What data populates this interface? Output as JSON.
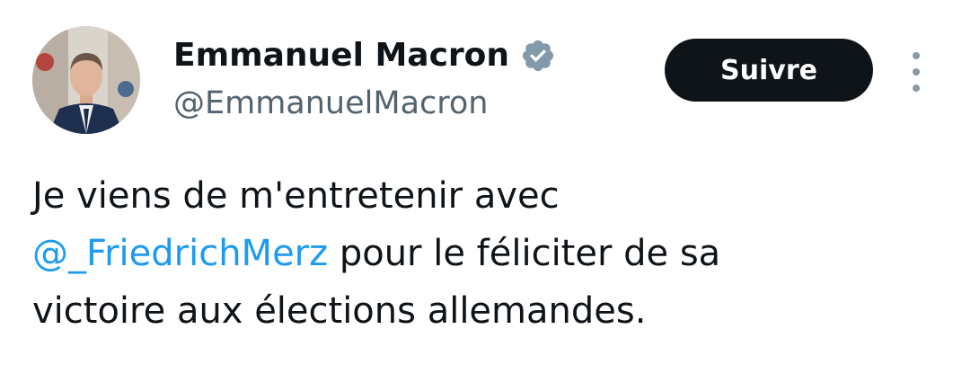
{
  "author": {
    "display_name": "Emmanuel Macron",
    "handle": "@EmmanuelMacron",
    "verified_icon": "verified-badge-icon",
    "avatar_icon": "profile-photo"
  },
  "actions": {
    "follow_label": "Suivre",
    "more_icon": "vertical-ellipsis-icon"
  },
  "tweet": {
    "line1": "Je viens de m'entretenir avec",
    "mention": "@_FriedrichMerz",
    "line2_rest": " pour le féliciter de sa",
    "line3": "victoire aux élections allemandes."
  },
  "colors": {
    "text": "#0f1419",
    "secondary": "#536471",
    "mention": "#1d9bf0",
    "button_bg": "#0f1419",
    "button_text": "#ffffff",
    "verified_badge": "#829aab"
  }
}
